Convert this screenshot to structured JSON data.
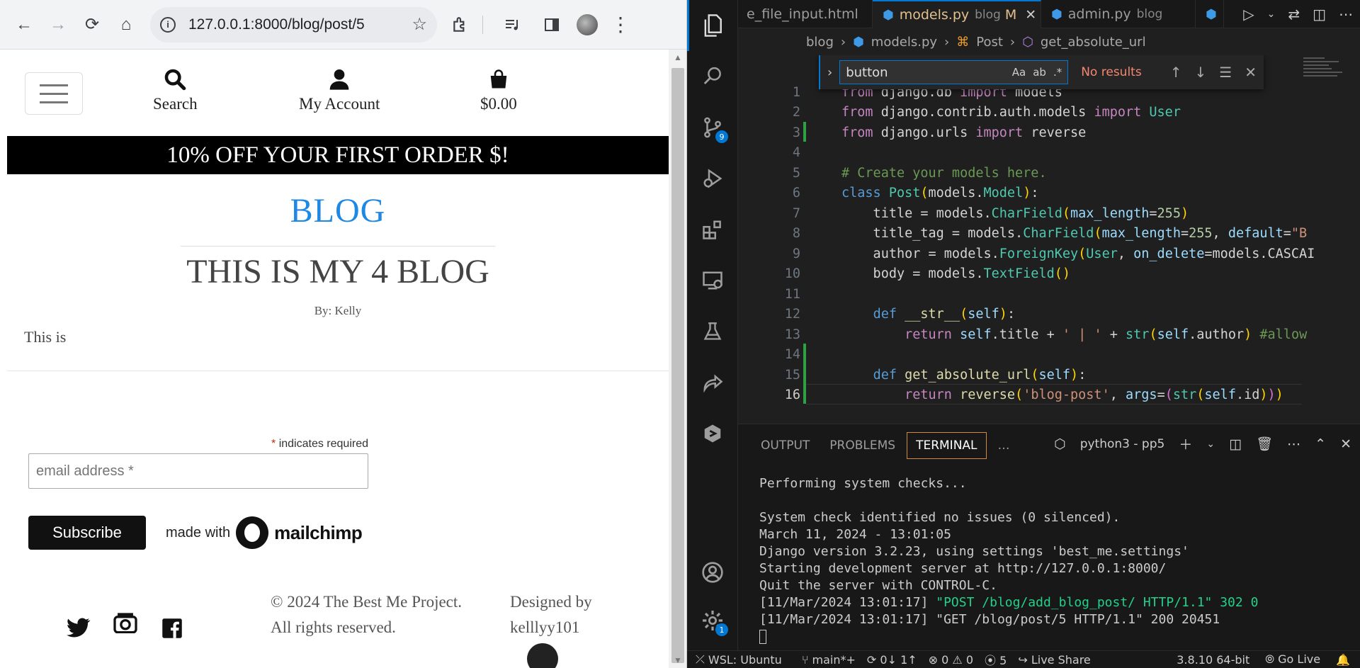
{
  "browser": {
    "url": "127.0.0.1:8000/blog/post/5",
    "nav": {
      "back": "←",
      "forward": "→",
      "reload": "⟳",
      "home": "⌂"
    },
    "icons": {
      "info": "i",
      "star": "☆",
      "extensions": "puzzle-icon",
      "media": "media-icon",
      "sidepanel": "sidepanel-icon",
      "menu": "⋮"
    }
  },
  "site": {
    "header": {
      "search_label": "Search",
      "account_label": "My Account",
      "cart_label": "$0.00"
    },
    "promo": "10% OFF YOUR FIRST ORDER $!",
    "blog_title": "BLOG",
    "post": {
      "title": "THIS IS MY 4 BLOG",
      "author": "By: Kelly",
      "body": "This is"
    },
    "mailchimp": {
      "required_marker": "*",
      "required_text": "indicates required",
      "email_placeholder": "email address *",
      "subscribe_label": "Subscribe",
      "made_with": "made with",
      "brand": "mailchimp"
    },
    "footer": {
      "copyright_line1": "© 2024 The Best Me Project.",
      "copyright_line2": "All rights reserved.",
      "designed_line1": "Designed by",
      "designed_line2": "kelllyy101"
    }
  },
  "vscode": {
    "tabs": [
      {
        "name": "e_file_input.html",
        "dir": "",
        "flag": ""
      },
      {
        "name": "models.py",
        "dir": "blog",
        "flag": "M"
      },
      {
        "name": "admin.py",
        "dir": "blog",
        "flag": ""
      }
    ],
    "breadcrumb": [
      "blog",
      "models.py",
      "Post",
      "get_absolute_url"
    ],
    "find": {
      "query": "button",
      "case": "Aa",
      "word": "ab",
      "regex": ".*",
      "result": "No results"
    },
    "code_lines": [
      "1",
      "2",
      "3",
      "4",
      "5",
      "6",
      "7",
      "8",
      "9",
      "10",
      "11",
      "12",
      "13",
      "14",
      "15",
      "16"
    ],
    "panel_tabs": [
      "OUTPUT",
      "PROBLEMS",
      "TERMINAL",
      "…"
    ],
    "terminal_name": "python3 - pp5",
    "terminal": {
      "l1": "Performing system checks...",
      "l2": "System check identified no issues (0 silenced).",
      "l3": "March 11, 2024 - 13:01:05",
      "l4": "Django version 3.2.23, using settings 'best_me.settings'",
      "l5": "Starting development server at http://127.0.0.1:8000/",
      "l6": "Quit the server with CONTROL-C.",
      "l7a": "[11/Mar/2024 13:01:17] ",
      "l7b": "\"POST /blog/add_blog_post/ HTTP/1.1\" 302 0",
      "l8": "[11/Mar/2024 13:01:17] \"GET /blog/post/5 HTTP/1.1\" 200 20451"
    },
    "activity_badges": {
      "scm": "9",
      "accounts": "1"
    },
    "status": {
      "remote": "WSL: Ubuntu",
      "branch": "main*+",
      "sync": "0↓ 1↑",
      "problems": "⊗ 0 ⚠ 0",
      "ports": "5",
      "liveshare": "Live Share",
      "python": "3.8.10 64-bit",
      "golive": "Go Live"
    }
  }
}
